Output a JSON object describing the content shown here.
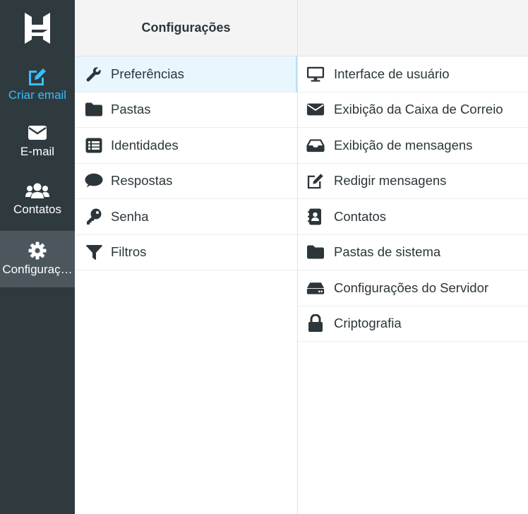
{
  "rail": {
    "items": [
      {
        "label": "Criar email",
        "icon": "compose-icon"
      },
      {
        "label": "E-mail",
        "icon": "envelope-icon"
      },
      {
        "label": "Contatos",
        "icon": "users-icon"
      },
      {
        "label": "Configuraç…",
        "icon": "gear-icon"
      }
    ],
    "compose_color": "#37beff"
  },
  "settings": {
    "title": "Configurações",
    "sections": [
      {
        "label": "Preferências",
        "icon": "wrench-icon"
      },
      {
        "label": "Pastas",
        "icon": "folder-icon"
      },
      {
        "label": "Identidades",
        "icon": "list-icon"
      },
      {
        "label": "Respostas",
        "icon": "comment-icon"
      },
      {
        "label": "Senha",
        "icon": "key-icon"
      },
      {
        "label": "Filtros",
        "icon": "filter-icon"
      }
    ],
    "selected_section": "Preferências"
  },
  "preferences": {
    "items": [
      {
        "label": "Interface de usuário",
        "icon": "monitor-icon"
      },
      {
        "label": "Exibição da Caixa de Correio",
        "icon": "envelope-icon"
      },
      {
        "label": "Exibição de mensagens",
        "icon": "inbox-icon"
      },
      {
        "label": "Redigir mensagens",
        "icon": "edit-icon"
      },
      {
        "label": "Contatos",
        "icon": "address-book-icon"
      },
      {
        "label": "Pastas de sistema",
        "icon": "folder-icon"
      },
      {
        "label": "Configurações do Servidor",
        "icon": "server-icon"
      },
      {
        "label": "Criptografia",
        "icon": "lock-icon"
      }
    ]
  }
}
